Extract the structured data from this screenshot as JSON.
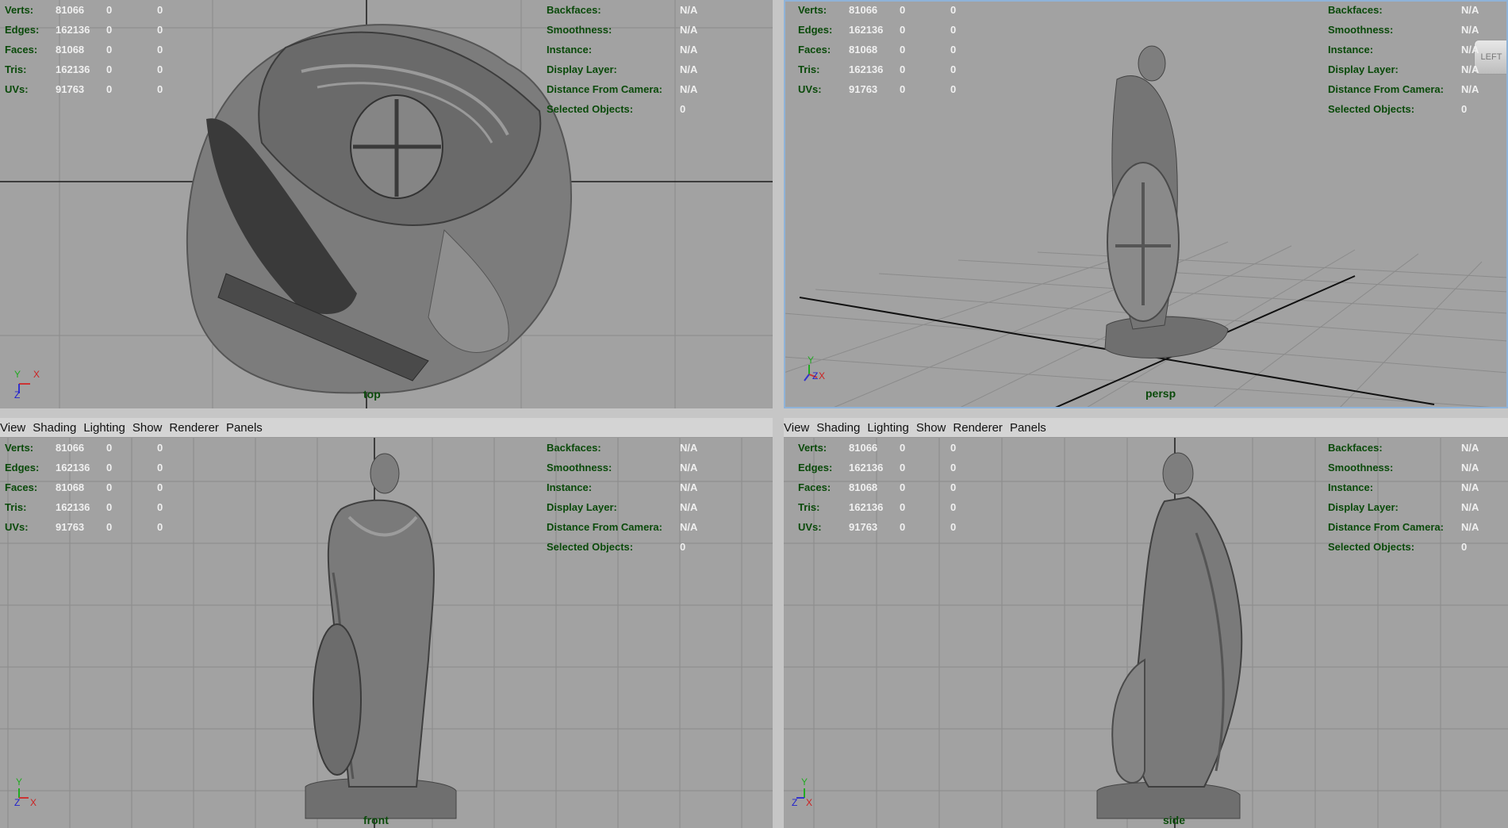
{
  "menu": [
    "View",
    "Shading",
    "Lighting",
    "Show",
    "Renderer",
    "Panels"
  ],
  "hud_left": [
    {
      "label": "Verts:",
      "v1": "81066",
      "v2": "0",
      "v3": "0"
    },
    {
      "label": "Edges:",
      "v1": "162136",
      "v2": "0",
      "v3": "0"
    },
    {
      "label": "Faces:",
      "v1": "81068",
      "v2": "0",
      "v3": "0"
    },
    {
      "label": "Tris:",
      "v1": "162136",
      "v2": "0",
      "v3": "0"
    },
    {
      "label": "UVs:",
      "v1": "91763",
      "v2": "0",
      "v3": "0"
    }
  ],
  "hud_right": [
    {
      "label": "Backfaces:",
      "value": "N/A"
    },
    {
      "label": "Smoothness:",
      "value": "N/A"
    },
    {
      "label": "Instance:",
      "value": "N/A"
    },
    {
      "label": "Display Layer:",
      "value": "N/A"
    },
    {
      "label": "Distance From Camera:",
      "value": "N/A"
    },
    {
      "label": "Selected Objects:",
      "value": "0"
    }
  ],
  "viewports": {
    "top": {
      "camera": "top",
      "axes": [
        "Y",
        "X",
        "Z"
      ]
    },
    "persp": {
      "camera": "persp",
      "axes": [
        "Y",
        "X",
        "Z"
      ],
      "viewcube": "LEFT"
    },
    "front": {
      "camera": "front",
      "axes": [
        "Y",
        "Z",
        "X"
      ]
    },
    "side": {
      "camera": "side",
      "axes": [
        "Y",
        "Z",
        "X"
      ]
    }
  },
  "colors": {
    "viewport_bg": "#a2a2a2",
    "hud_label": "#0a4a0a",
    "hud_value": "#f0f0f0",
    "active_border": "#8fb3d8"
  }
}
